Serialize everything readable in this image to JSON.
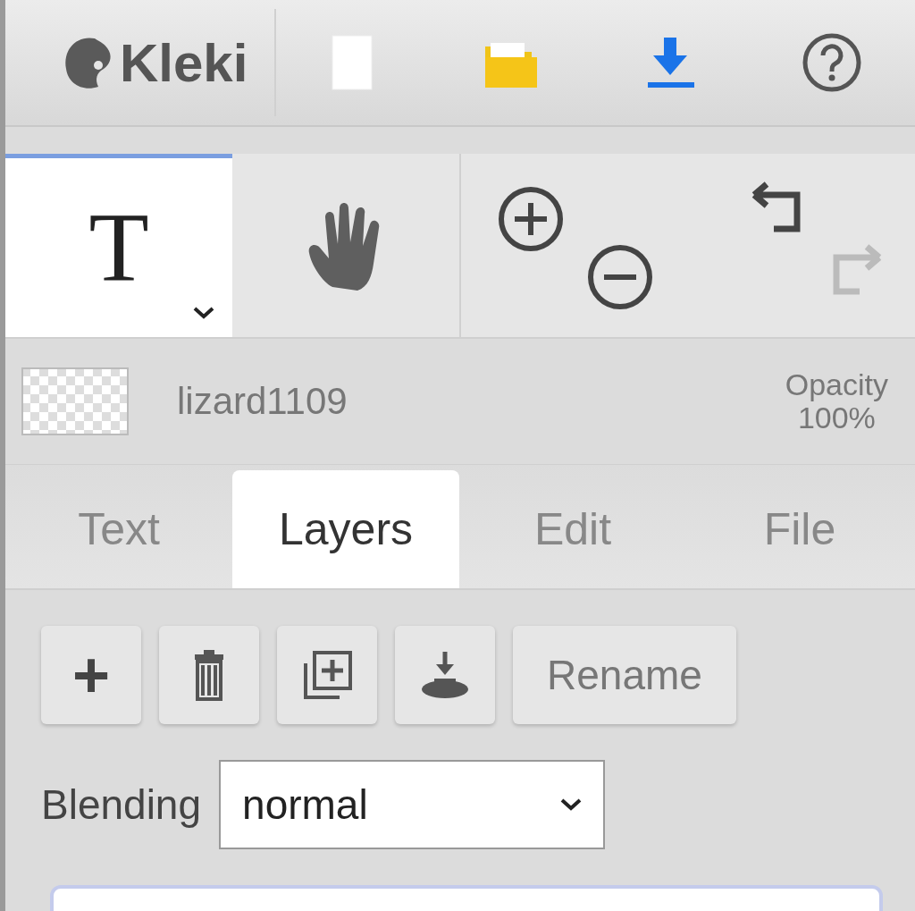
{
  "app": {
    "logo": "Kleki"
  },
  "top_actions": [
    {
      "kind": "new"
    },
    {
      "kind": "open"
    },
    {
      "kind": "download"
    },
    {
      "kind": "help"
    }
  ],
  "tools": [
    {
      "kind": "text",
      "glyph": "T",
      "selected": true
    },
    {
      "kind": "hand",
      "selected": false
    }
  ],
  "history": [
    {
      "kind": "undo",
      "disabled": false
    },
    {
      "kind": "redo",
      "disabled": true
    }
  ],
  "layer": {
    "name": "lizard1109",
    "opacity_label": "Opacity",
    "opacity_value": "100%"
  },
  "tabs": [
    {
      "label": "Text",
      "selected": false
    },
    {
      "label": "Layers",
      "selected": true
    },
    {
      "label": "Edit",
      "selected": false
    },
    {
      "label": "File",
      "selected": false
    }
  ],
  "layer_actions": [
    {
      "kind": "add",
      "glyph": "+"
    },
    {
      "kind": "delete"
    },
    {
      "kind": "duplicate"
    },
    {
      "kind": "merge"
    },
    {
      "kind": "rename",
      "label": "Rename"
    }
  ],
  "blending": {
    "label": "Blending",
    "value": "normal"
  }
}
